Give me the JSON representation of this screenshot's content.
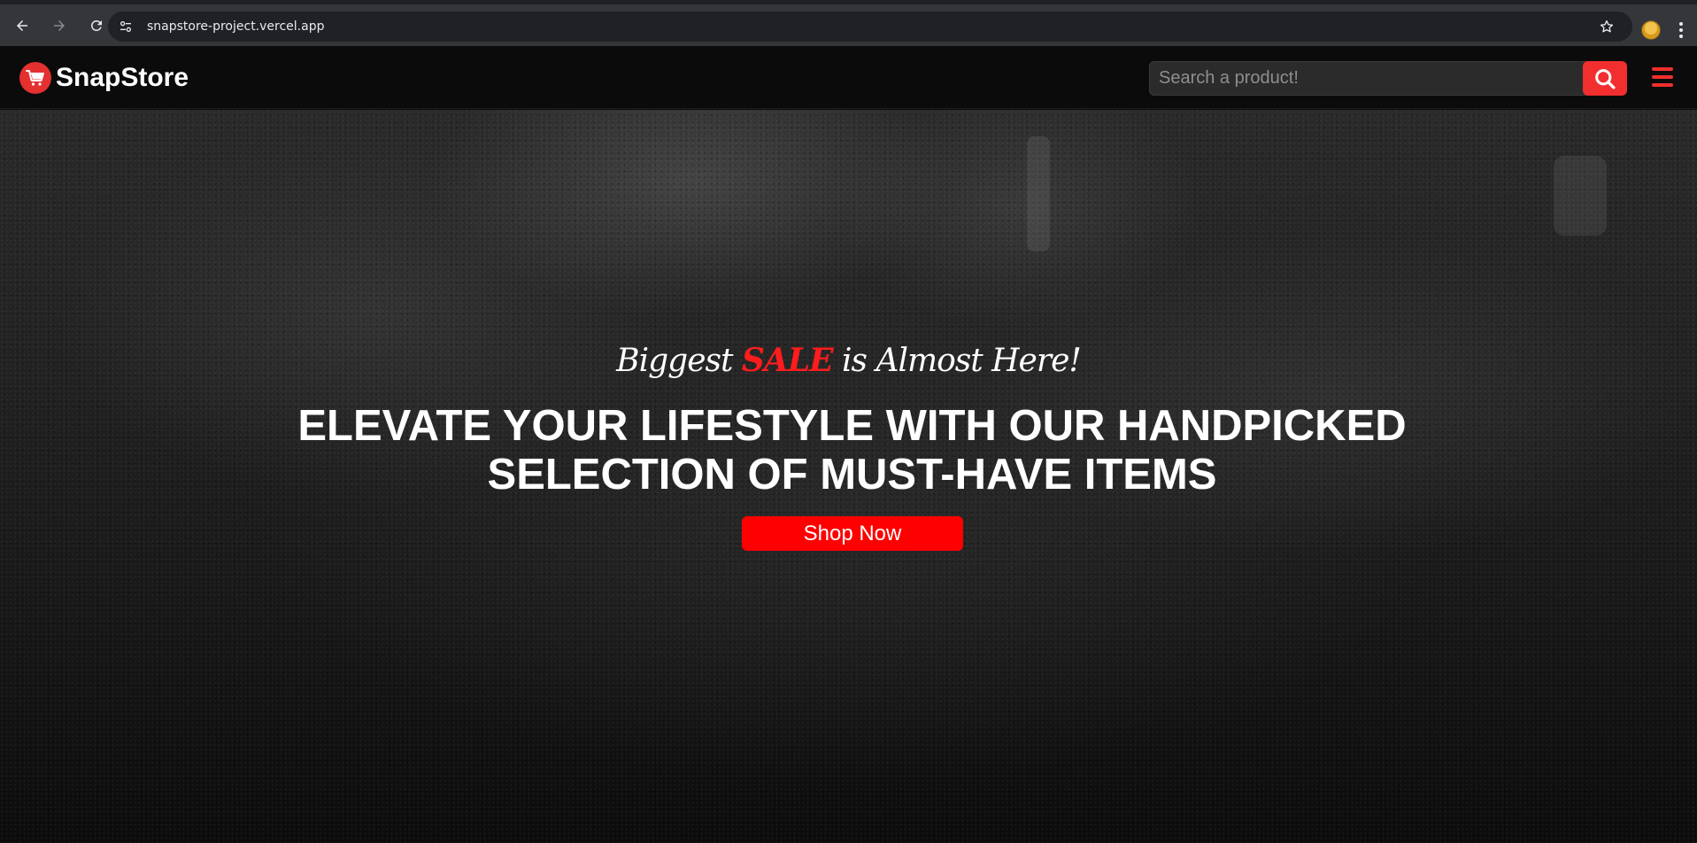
{
  "browser": {
    "url": "snapstore-project.vercel.app"
  },
  "header": {
    "brand": "SnapStore",
    "search": {
      "placeholder": "Search a product!"
    }
  },
  "hero": {
    "tagline_before": "Biggest ",
    "tagline_sale": "SALE",
    "tagline_after": " is Almost Here!",
    "headline_line1": "ELEVATE YOUR LIFESTYLE WITH OUR HANDPICKED",
    "headline_line2": "SELECTION OF MUST-HAVE ITEMS",
    "cta_label": "Shop Now"
  },
  "colors": {
    "accent_red": "#f22f2f",
    "sale_red": "#ff1c1c",
    "header_bg": "#0b0b0b",
    "chrome_bg": "#35363a"
  },
  "icons": {
    "back": "back-arrow-icon",
    "forward": "forward-arrow-icon",
    "reload": "reload-icon",
    "site_info": "tune-icon",
    "bookmark": "star-icon",
    "logo": "cart-icon",
    "search": "search-icon",
    "menu": "hamburger-menu-icon"
  }
}
